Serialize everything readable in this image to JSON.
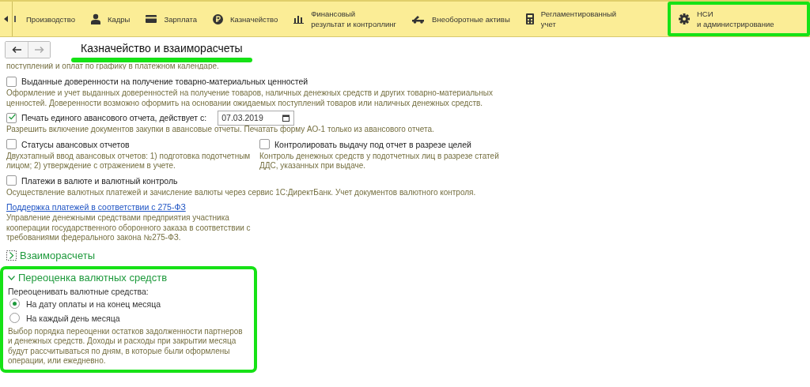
{
  "nav": {
    "items": [
      {
        "label": "Производство",
        "highlighted": false
      },
      {
        "label": "Кадры",
        "highlighted": false
      },
      {
        "label": "Зарплата",
        "highlighted": false
      },
      {
        "label": "Казначейство",
        "highlighted": false
      },
      {
        "label": "Финансовый\nрезультат и контроллинг",
        "highlighted": false
      },
      {
        "label": "Внеоборотные активы",
        "highlighted": false
      },
      {
        "label": "Регламентированный\nучет",
        "highlighted": false
      },
      {
        "label": "НСИ\nи администрирование",
        "highlighted": true
      }
    ]
  },
  "page_title": {
    "text": "Казначейство и взаиморасчеты",
    "highlighted": true
  },
  "settings": [
    {
      "kind": "note",
      "text": "поступлений и оплат по графику в платежном календаре."
    },
    {
      "kind": "checkbox",
      "label": "Выданные доверенности на получение товарно-материальных ценностей",
      "checked": false,
      "description": "Оформление и учет выданных доверенностей на получение товаров, наличных денежных средств и других товарно-материальных ценностей. Доверенности возможно оформить на основании ожидаемых поступлений товаров или наличных денежных средств."
    },
    {
      "kind": "checkbox_date",
      "label": "Печать единого авансового отчета, действует с:",
      "checked": true,
      "date": "07.03.2019",
      "description": "Разрешить включение документов закупки в авансовые отчеты. Печатать форму АО-1 только из авансового отчета."
    },
    {
      "kind": "pair",
      "items": [
        {
          "label": "Статусы авансовых отчетов",
          "checked": false,
          "description": "Двухэтапный ввод авансовых отчетов: 1) подготовка подотчетным лицом; 2) утверждение с отражением в учете."
        },
        {
          "label": "Контролировать выдачу под отчет в разрезе целей",
          "checked": false,
          "description": "Контроль денежных средств у подотчетных лиц в разрезе статей ДДС, указанных при выдаче."
        }
      ]
    },
    {
      "kind": "checkbox",
      "label": "Платежи в валюте и валютный контроль",
      "checked": false,
      "description": "Осуществление валютных платежей и зачисление валюты через сервис 1С:ДиректБанк. Учет документов валютного контроля."
    },
    {
      "kind": "link",
      "label": "Поддержка платежей в соответствии с 275-ФЗ",
      "description": "Управление денежными средствами предприятия участника кооперации государственного оборонного заказа в соответствии с требованиями федерального закона №275-ФЗ."
    }
  ],
  "sections": [
    {
      "title": "Взаиморасчеты",
      "expanded": false,
      "highlighted": false
    },
    {
      "title": "Переоценка валютных средств",
      "expanded": true,
      "highlighted": true,
      "prompt": "Переоценивать валютные средства:",
      "options": [
        {
          "label": "На дату оплаты и на конец месяца",
          "selected": true
        },
        {
          "label": "На каждый день месяца",
          "selected": false
        }
      ],
      "description": "Выбор порядка переоценки остатков задолженности партнеров и денежных средств. Доходы и расходы при закрытии месяца будут рассчитываться по дням, в которые были оформлены операции, или ежедневно."
    }
  ]
}
